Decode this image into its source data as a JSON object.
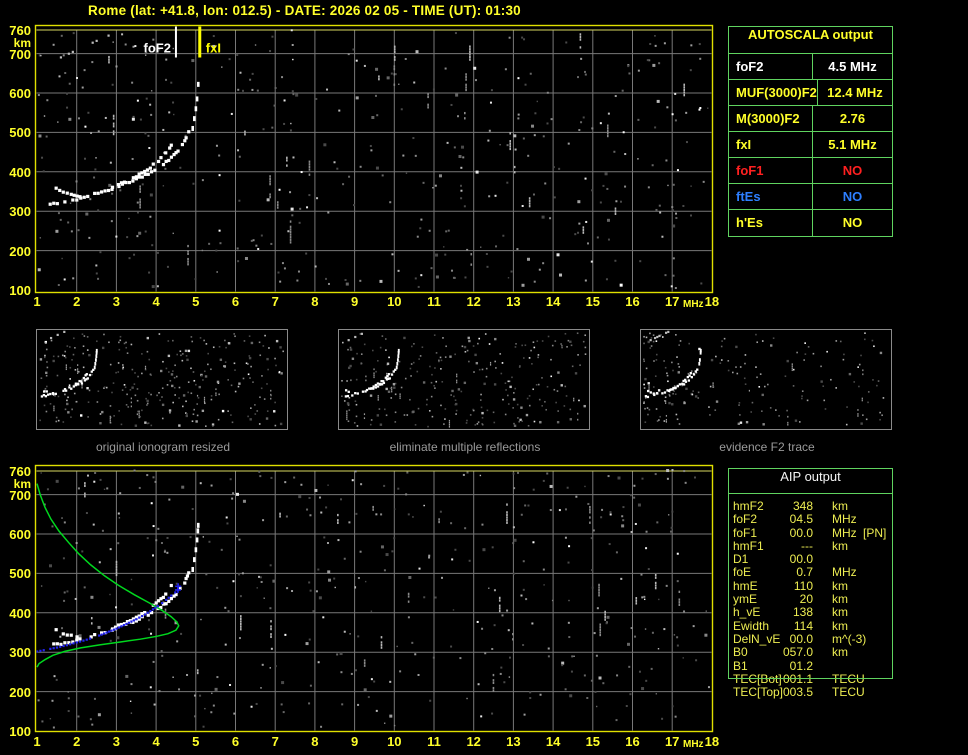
{
  "window": {
    "title": "Rome (lat: +41.8, lon: 012.5) - DATE: 2026 02 05 - TIME (UT): 01:30"
  },
  "colors": {
    "background": "#000000",
    "axis_text": "#ffff2a",
    "plot_frame": "#e0e000",
    "grid": "#787878",
    "table_border": "#5fd35f",
    "white_trace": "#ffffff",
    "fitted_trace_blue": "#2222ee",
    "profile_green": "#00d81e",
    "no_red": "#ff2020",
    "ftes_blue": "#2e7fff",
    "caption_gray": "#9a9a9a"
  },
  "autoscala_table": {
    "title": "AUTOSCALA output",
    "rows": [
      {
        "param": "foF2",
        "value": "4.5 MHz",
        "color": "#ffffff"
      },
      {
        "param": "MUF(3000)F2",
        "value": "12.4 MHz",
        "color": "#ffff2a"
      },
      {
        "param": "M(3000)F2",
        "value": "2.76",
        "color": "#ffff2a"
      },
      {
        "param": "fxI",
        "value": "5.1 MHz",
        "color": "#ffff2a"
      },
      {
        "param": "foF1",
        "value": "NO",
        "color": "#ff2020"
      },
      {
        "param": "ftEs",
        "value": "NO",
        "color": "#2e7fff"
      },
      {
        "param": "h'Es",
        "value": "NO",
        "color": "#ffff2a"
      }
    ]
  },
  "aip_table": {
    "title": "AIP output",
    "rows": [
      {
        "param": "hmF2",
        "value": "348",
        "unit": "km",
        "extra": ""
      },
      {
        "param": "foF2",
        "value": "04.5",
        "unit": "MHz",
        "extra": ""
      },
      {
        "param": "foF1",
        "value": "00.0",
        "unit": "MHz",
        "extra": "[PN]"
      },
      {
        "param": "hmF1",
        "value": "---",
        "unit": "km",
        "extra": ""
      },
      {
        "param": "D1",
        "value": "00.0",
        "unit": "",
        "extra": ""
      },
      {
        "param": "foE",
        "value": "0.7",
        "unit": "MHz",
        "extra": ""
      },
      {
        "param": "hmE",
        "value": "110",
        "unit": "km",
        "extra": ""
      },
      {
        "param": "ymE",
        "value": "20",
        "unit": "km",
        "extra": ""
      },
      {
        "param": "h_vE",
        "value": "138",
        "unit": "km",
        "extra": ""
      },
      {
        "param": "Ewidth",
        "value": "114",
        "unit": "km",
        "extra": ""
      },
      {
        "param": "DelN_vE",
        "value": "00.0",
        "unit": "m^(-3)",
        "extra": ""
      },
      {
        "param": "B0",
        "value": "057.0",
        "unit": "km",
        "extra": ""
      },
      {
        "param": "B1",
        "value": "01.2",
        "unit": "",
        "extra": ""
      },
      {
        "param": "TEC[Bot]",
        "value": "001.1",
        "unit": "TECU",
        "extra": ""
      },
      {
        "param": "TEC[Top]",
        "value": "003.5",
        "unit": "TECU",
        "extra": ""
      }
    ]
  },
  "thumbnails": [
    {
      "caption": "original ionogram resized"
    },
    {
      "caption": "eliminate multiple reflections"
    },
    {
      "caption": "evidence F2 trace"
    }
  ],
  "chart_data": {
    "type": "scatter",
    "xlabel": "MHz",
    "ylabel": "km",
    "xlim": [
      1,
      18
    ],
    "ylim": [
      100,
      760
    ],
    "x_ticks": [
      "1",
      "2",
      "3",
      "4",
      "5",
      "6",
      "7",
      "8",
      "9",
      "10",
      "11",
      "12",
      "13",
      "14",
      "15",
      "16",
      "17",
      "18"
    ],
    "x_unit": "MHz",
    "y_ticks": [
      "760",
      "700",
      "600",
      "500",
      "400",
      "300",
      "200",
      "100"
    ],
    "y_tick_values": [
      760,
      700,
      600,
      500,
      400,
      300,
      200,
      100
    ],
    "y_unit": "km",
    "grid": true,
    "plots": [
      {
        "name": "scaled-ionogram",
        "series": [
          "f2_trace_main",
          "f2_trace_hook",
          "f2_trace_upper",
          "f2_asymptote",
          "high_trail"
        ],
        "markers": [
          {
            "label": "foF2",
            "mhz": 4.5,
            "color": "#ffffff",
            "side": "left"
          },
          {
            "label": "fxI",
            "mhz": 5.1,
            "color": "#ffff00",
            "side": "right"
          }
        ]
      },
      {
        "name": "profile-fit-ionogram",
        "series": [
          "f2_trace_main",
          "f2_trace_hook",
          "f2_trace_upper",
          "f2_asymptote",
          "profile",
          "fitted_trace"
        ],
        "markers": []
      }
    ],
    "series_points": {
      "f2_trace_main": {
        "color": "#ffffff",
        "style": "dots",
        "points": [
          [
            1.33,
            318
          ],
          [
            1.6,
            322
          ],
          [
            1.9,
            328
          ],
          [
            2.1,
            334
          ],
          [
            2.45,
            344
          ],
          [
            2.8,
            355
          ],
          [
            3.15,
            367
          ],
          [
            3.5,
            381
          ],
          [
            3.8,
            395
          ],
          [
            4.05,
            410
          ],
          [
            4.25,
            425
          ],
          [
            4.45,
            442
          ],
          [
            4.6,
            460
          ],
          [
            4.72,
            478
          ],
          [
            4.82,
            500
          ]
        ]
      },
      "f2_trace_hook": {
        "color": "#ffffff",
        "style": "dots",
        "points": [
          [
            1.48,
            357
          ],
          [
            1.66,
            349
          ],
          [
            1.86,
            342
          ],
          [
            2.08,
            336
          ]
        ]
      },
      "f2_trace_upper": {
        "color": "#ffffff",
        "style": "dots",
        "points": [
          [
            2.9,
            361
          ],
          [
            3.2,
            373
          ],
          [
            3.5,
            389
          ],
          [
            3.78,
            406
          ],
          [
            4.0,
            423
          ],
          [
            4.18,
            440
          ],
          [
            4.3,
            455
          ],
          [
            4.38,
            467
          ]
        ]
      },
      "f2_asymptote": {
        "color": "#ffffff",
        "style": "dashes",
        "points": [
          [
            4.92,
            510
          ],
          [
            4.96,
            535
          ],
          [
            5.0,
            560
          ],
          [
            5.03,
            585
          ],
          [
            5.05,
            608
          ],
          [
            5.06,
            622
          ]
        ]
      },
      "high_trail": {
        "color": "#bbbbbb",
        "style": "sparse",
        "points": [
          [
            1.5,
            686
          ],
          [
            1.8,
            700
          ],
          [
            2.1,
            714
          ],
          [
            2.4,
            728
          ],
          [
            2.7,
            742
          ],
          [
            3.0,
            754
          ]
        ]
      },
      "fitted_trace": {
        "color": "#2222ee",
        "style": "plus",
        "points": [
          [
            1.0,
            302
          ],
          [
            1.25,
            307
          ],
          [
            1.5,
            312
          ],
          [
            1.75,
            318
          ],
          [
            2.0,
            325
          ],
          [
            2.25,
            332
          ],
          [
            2.5,
            340
          ],
          [
            2.75,
            350
          ],
          [
            3.0,
            360
          ],
          [
            3.25,
            372
          ],
          [
            3.5,
            384
          ],
          [
            3.72,
            396
          ],
          [
            3.92,
            409
          ],
          [
            4.1,
            421
          ],
          [
            4.25,
            433
          ],
          [
            4.38,
            444
          ],
          [
            4.48,
            452
          ],
          [
            4.55,
            458
          ]
        ]
      },
      "profile": {
        "color": "#00d81e",
        "style": "line",
        "points": [
          [
            1.0,
            728
          ],
          [
            1.08,
            700
          ],
          [
            1.2,
            668
          ],
          [
            1.35,
            638
          ],
          [
            1.55,
            608
          ],
          [
            1.8,
            578
          ],
          [
            2.05,
            550
          ],
          [
            2.35,
            522
          ],
          [
            2.7,
            494
          ],
          [
            3.05,
            470
          ],
          [
            3.45,
            446
          ],
          [
            3.85,
            424
          ],
          [
            4.15,
            406
          ],
          [
            4.38,
            390
          ],
          [
            4.52,
            377
          ],
          [
            4.57,
            367
          ],
          [
            4.5,
            356
          ],
          [
            4.3,
            347
          ],
          [
            4.0,
            340
          ],
          [
            3.6,
            333
          ],
          [
            3.1,
            326
          ],
          [
            2.6,
            319
          ],
          [
            2.1,
            311
          ],
          [
            1.7,
            302
          ],
          [
            1.4,
            292
          ],
          [
            1.2,
            281
          ],
          [
            1.05,
            271
          ],
          [
            1.0,
            262
          ]
        ]
      }
    }
  },
  "noise": {
    "seed": 20260205,
    "plot_dots": 430,
    "plot_streaks": 26,
    "thumb_dots": [
      300,
      260,
      185
    ]
  }
}
